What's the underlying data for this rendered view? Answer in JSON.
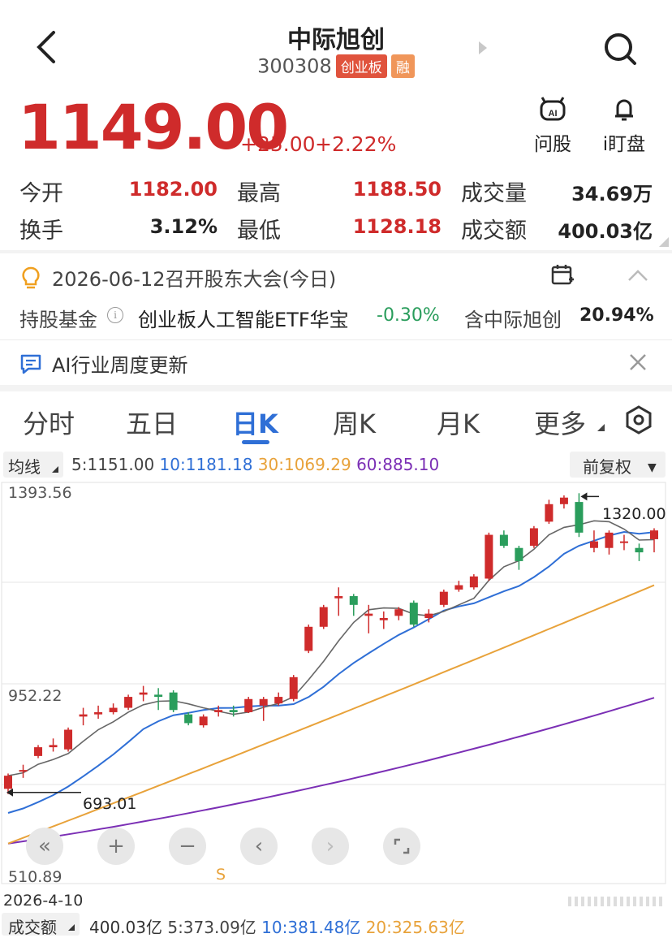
{
  "header": {
    "title": "中际旭创",
    "code": "300308",
    "board_tag": "创业板",
    "margin_tag": "融",
    "ask_label": "问股",
    "watch_label": "i盯盘"
  },
  "quote": {
    "price": "1149.00",
    "change": "+25.00",
    "change_pct": "+2.22%"
  },
  "stats": {
    "open_label": "今开",
    "open": "1182.00",
    "high_label": "最高",
    "high": "1188.50",
    "vol_label": "成交量",
    "vol": "34.69万",
    "turnover_label": "换手",
    "turnover": "3.12%",
    "low_label": "最低",
    "low": "1128.18",
    "amount_label": "成交额",
    "amount": "400.03亿"
  },
  "notice": {
    "meeting": "2026-06-12召开股东大会(今日)",
    "fund_label": "持股基金",
    "fund_name": "创业板人工智能ETF华宝",
    "fund_change": "-0.30%",
    "holding_label": "含中际旭创",
    "holding_pct": "20.94%"
  },
  "ai_banner": {
    "text": "AI行业周度更新"
  },
  "tabs": [
    "分时",
    "五日",
    "日K",
    "周K",
    "月K",
    "更多"
  ],
  "ma_bar": {
    "selector": "均线",
    "ma5": "5:1151.00",
    "ma10": "10:1181.18",
    "ma30": "30:1069.29",
    "ma60": "60:885.10",
    "adjust": "前复权"
  },
  "vol_bar": {
    "selector": "成交额",
    "total": "400.03亿",
    "ma5": "5:373.09亿",
    "ma10": "10:381.48亿",
    "ma20": "20:325.63亿"
  },
  "chart_data": {
    "type": "candlestick",
    "y_ticks": [
      "1393.56",
      "952.22",
      "510.89"
    ],
    "ylim": [
      510.89,
      1393.56
    ],
    "start_date": "2026-4-10",
    "high_marker": "1320.00",
    "low_marker": "693.01",
    "signal_label": "S",
    "candles": [
      {
        "o": 705,
        "c": 735,
        "h": 740,
        "l": 693
      },
      {
        "o": 745,
        "c": 748,
        "h": 760,
        "l": 730
      },
      {
        "o": 780,
        "c": 800,
        "h": 805,
        "l": 775
      },
      {
        "o": 800,
        "c": 805,
        "h": 820,
        "l": 790
      },
      {
        "o": 795,
        "c": 840,
        "h": 845,
        "l": 790
      },
      {
        "o": 870,
        "c": 875,
        "h": 890,
        "l": 850
      },
      {
        "o": 875,
        "c": 880,
        "h": 895,
        "l": 865
      },
      {
        "o": 880,
        "c": 890,
        "h": 900,
        "l": 875
      },
      {
        "o": 890,
        "c": 915,
        "h": 920,
        "l": 885
      },
      {
        "o": 920,
        "c": 925,
        "h": 940,
        "l": 905
      },
      {
        "o": 920,
        "c": 915,
        "h": 935,
        "l": 885
      },
      {
        "o": 925,
        "c": 885,
        "h": 930,
        "l": 880
      },
      {
        "o": 875,
        "c": 855,
        "h": 880,
        "l": 850
      },
      {
        "o": 850,
        "c": 870,
        "h": 875,
        "l": 845
      },
      {
        "o": 880,
        "c": 885,
        "h": 895,
        "l": 870
      },
      {
        "o": 885,
        "c": 880,
        "h": 895,
        "l": 870
      },
      {
        "o": 880,
        "c": 910,
        "h": 915,
        "l": 878
      },
      {
        "o": 895,
        "c": 910,
        "h": 915,
        "l": 860
      },
      {
        "o": 900,
        "c": 915,
        "h": 925,
        "l": 895
      },
      {
        "o": 910,
        "c": 960,
        "h": 965,
        "l": 905
      },
      {
        "o": 1020,
        "c": 1075,
        "h": 1080,
        "l": 1015
      },
      {
        "o": 1075,
        "c": 1120,
        "h": 1125,
        "l": 1070
      },
      {
        "o": 1140,
        "c": 1145,
        "h": 1165,
        "l": 1100
      },
      {
        "o": 1145,
        "c": 1125,
        "h": 1150,
        "l": 1100
      },
      {
        "o": 1100,
        "c": 1105,
        "h": 1125,
        "l": 1060
      },
      {
        "o": 1090,
        "c": 1095,
        "h": 1110,
        "l": 1070
      },
      {
        "o": 1100,
        "c": 1115,
        "h": 1120,
        "l": 1090
      },
      {
        "o": 1130,
        "c": 1080,
        "h": 1135,
        "l": 1075
      },
      {
        "o": 1095,
        "c": 1105,
        "h": 1115,
        "l": 1085
      },
      {
        "o": 1125,
        "c": 1155,
        "h": 1160,
        "l": 1120
      },
      {
        "o": 1160,
        "c": 1170,
        "h": 1180,
        "l": 1155
      },
      {
        "o": 1165,
        "c": 1190,
        "h": 1195,
        "l": 1160
      },
      {
        "o": 1185,
        "c": 1285,
        "h": 1290,
        "l": 1180
      },
      {
        "o": 1285,
        "c": 1260,
        "h": 1295,
        "l": 1255
      },
      {
        "o": 1255,
        "c": 1225,
        "h": 1260,
        "l": 1205
      },
      {
        "o": 1260,
        "c": 1300,
        "h": 1305,
        "l": 1255
      },
      {
        "o": 1315,
        "c": 1355,
        "h": 1365,
        "l": 1310
      },
      {
        "o": 1355,
        "c": 1370,
        "h": 1375,
        "l": 1345
      },
      {
        "o": 1360,
        "c": 1290,
        "h": 1380,
        "l": 1280
      },
      {
        "o": 1255,
        "c": 1270,
        "h": 1295,
        "l": 1245
      },
      {
        "o": 1255,
        "c": 1290,
        "h": 1295,
        "l": 1240
      },
      {
        "o": 1270,
        "c": 1270,
        "h": 1285,
        "l": 1250
      },
      {
        "o": 1255,
        "c": 1245,
        "h": 1265,
        "l": 1225
      },
      {
        "o": 1275,
        "c": 1295,
        "h": 1300,
        "l": 1245
      }
    ],
    "ma_lines": [
      {
        "name": "5",
        "color": "#666666",
        "start": 693,
        "end": 1280
      },
      {
        "name": "10",
        "color": "#2f6fd6",
        "start": 650,
        "end": 1294
      },
      {
        "name": "30",
        "color": "#e8a23a",
        "start": 580,
        "end": 1170
      },
      {
        "name": "60",
        "color": "#7b2fb5",
        "start": 580,
        "end": 913
      }
    ]
  },
  "colors": {
    "up": "#cf2b2b",
    "down": "#2a9d5c",
    "accent": "#2f6fd6"
  }
}
